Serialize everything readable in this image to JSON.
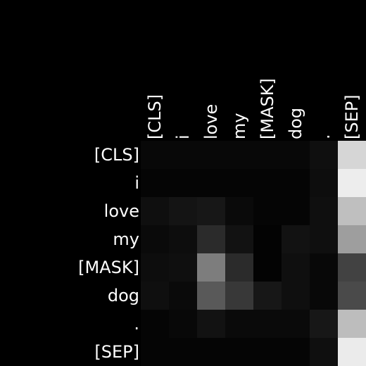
{
  "chart_data": {
    "type": "heatmap",
    "title": "",
    "xlabel": "",
    "ylabel": "",
    "x_tokens": [
      "[CLS]",
      "i",
      "love",
      "my",
      "[MASK]",
      "dog",
      ".",
      "[SEP]"
    ],
    "y_tokens": [
      "[CLS]",
      "i",
      "love",
      "my",
      "[MASK]",
      "dog",
      ".",
      "[SEP]"
    ],
    "value_range": [
      0,
      1
    ],
    "colormap": "grayscale (black = 0, white = 1)",
    "values": [
      [
        0.03,
        0.03,
        0.03,
        0.03,
        0.03,
        0.03,
        0.06,
        0.84
      ],
      [
        0.02,
        0.02,
        0.02,
        0.02,
        0.02,
        0.02,
        0.05,
        0.93
      ],
      [
        0.06,
        0.08,
        0.09,
        0.04,
        0.02,
        0.02,
        0.06,
        0.75
      ],
      [
        0.04,
        0.05,
        0.17,
        0.07,
        0.01,
        0.07,
        0.06,
        0.62
      ],
      [
        0.05,
        0.06,
        0.49,
        0.17,
        0.01,
        0.06,
        0.03,
        0.26
      ],
      [
        0.06,
        0.04,
        0.35,
        0.22,
        0.09,
        0.06,
        0.03,
        0.29
      ],
      [
        0.02,
        0.03,
        0.07,
        0.04,
        0.04,
        0.04,
        0.09,
        0.74
      ],
      [
        0.02,
        0.02,
        0.02,
        0.02,
        0.02,
        0.02,
        0.06,
        0.92
      ]
    ]
  },
  "colors": {
    "background": "#000000",
    "label": "#ffffff"
  }
}
